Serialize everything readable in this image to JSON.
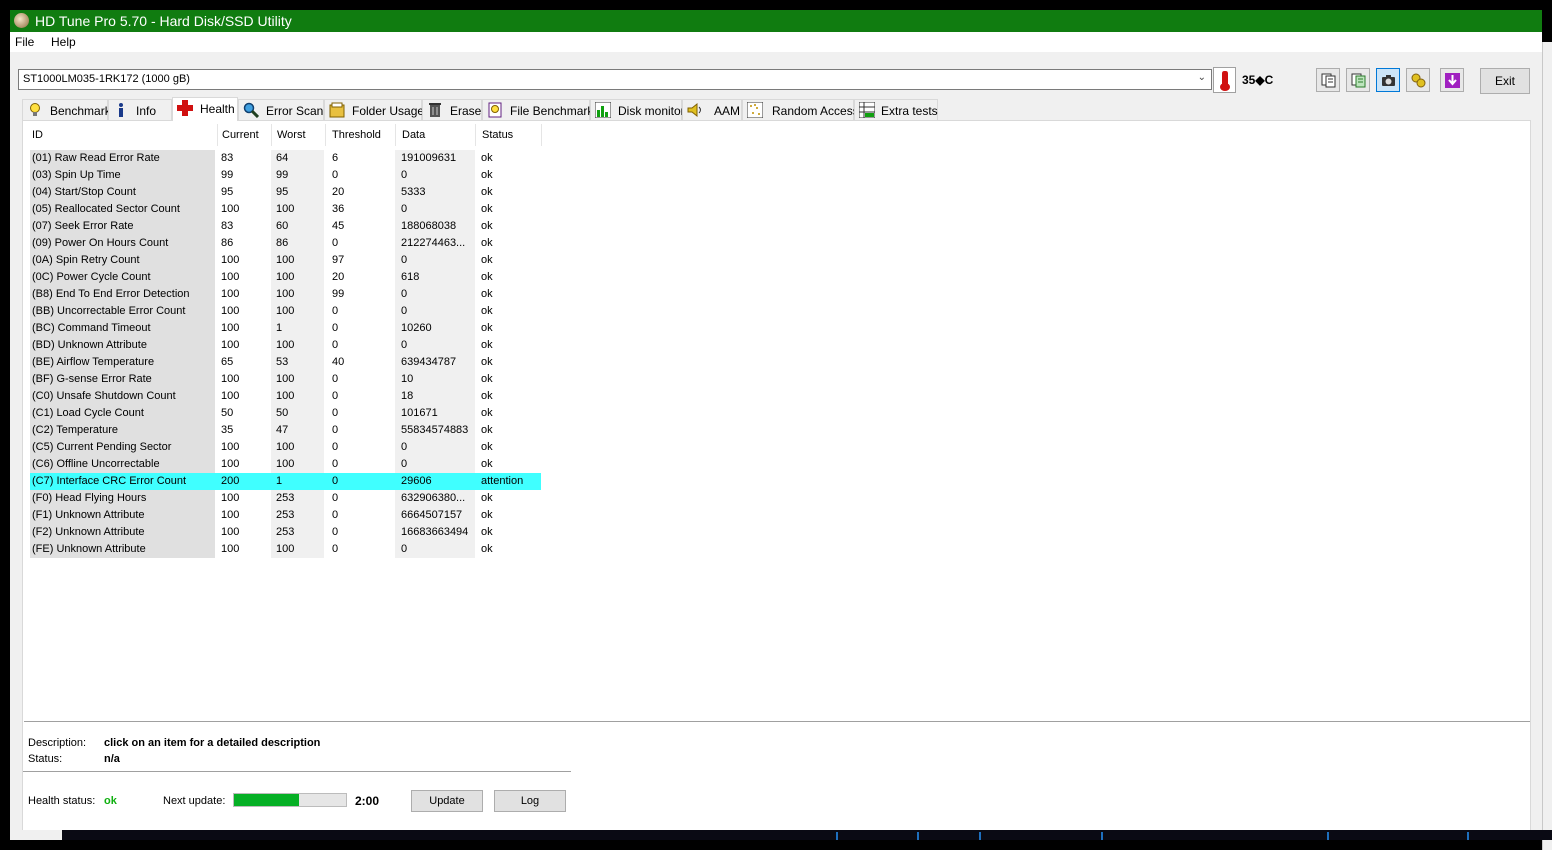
{
  "window": {
    "title": "HD Tune Pro 5.70 - Hard Disk/SSD Utility"
  },
  "menu": {
    "file": "File",
    "help": "Help"
  },
  "toolbar": {
    "drive": "ST1000LM035-1RK172 (1000 gB)",
    "temperature": "35◆C",
    "exit_label": "Exit",
    "icons": [
      "copy-icon",
      "copy-all-icon",
      "screenshot-icon",
      "options-icon",
      "save-icon"
    ]
  },
  "tabs": [
    {
      "label": "Benchmark",
      "icon": "benchmark-icon"
    },
    {
      "label": "Info",
      "icon": "info-icon"
    },
    {
      "label": "Health",
      "icon": "health-icon"
    },
    {
      "label": "Error Scan",
      "icon": "error-scan-icon"
    },
    {
      "label": "Folder Usage",
      "icon": "folder-icon"
    },
    {
      "label": "Erase",
      "icon": "erase-icon"
    },
    {
      "label": "File Benchmark",
      "icon": "file-benchmark-icon"
    },
    {
      "label": "Disk monitor",
      "icon": "disk-monitor-icon"
    },
    {
      "label": "AAM",
      "icon": "speaker-icon"
    },
    {
      "label": "Random Access",
      "icon": "random-access-icon"
    },
    {
      "label": "Extra tests",
      "icon": "extra-tests-icon"
    }
  ],
  "active_tab": "Health",
  "table": {
    "headers": [
      "ID",
      "Current",
      "Worst",
      "Threshold",
      "Data",
      "Status"
    ],
    "rows": [
      [
        "(01) Raw Read Error Rate",
        "83",
        "64",
        "6",
        "191009631",
        "ok"
      ],
      [
        "(03) Spin Up Time",
        "99",
        "99",
        "0",
        "0",
        "ok"
      ],
      [
        "(04) Start/Stop Count",
        "95",
        "95",
        "20",
        "5333",
        "ok"
      ],
      [
        "(05) Reallocated Sector Count",
        "100",
        "100",
        "36",
        "0",
        "ok"
      ],
      [
        "(07) Seek Error Rate",
        "83",
        "60",
        "45",
        "188068038",
        "ok"
      ],
      [
        "(09) Power On Hours Count",
        "86",
        "86",
        "0",
        "212274463...",
        "ok"
      ],
      [
        "(0A) Spin Retry Count",
        "100",
        "100",
        "97",
        "0",
        "ok"
      ],
      [
        "(0C) Power Cycle Count",
        "100",
        "100",
        "20",
        "618",
        "ok"
      ],
      [
        "(B8) End To End Error Detection",
        "100",
        "100",
        "99",
        "0",
        "ok"
      ],
      [
        "(BB) Uncorrectable Error Count",
        "100",
        "100",
        "0",
        "0",
        "ok"
      ],
      [
        "(BC) Command Timeout",
        "100",
        "1",
        "0",
        "10260",
        "ok"
      ],
      [
        "(BD) Unknown Attribute",
        "100",
        "100",
        "0",
        "0",
        "ok"
      ],
      [
        "(BE) Airflow Temperature",
        "65",
        "53",
        "40",
        "639434787",
        "ok"
      ],
      [
        "(BF) G-sense Error Rate",
        "100",
        "100",
        "0",
        "10",
        "ok"
      ],
      [
        "(C0) Unsafe Shutdown Count",
        "100",
        "100",
        "0",
        "18",
        "ok"
      ],
      [
        "(C1) Load Cycle Count",
        "50",
        "50",
        "0",
        "101671",
        "ok"
      ],
      [
        "(C2) Temperature",
        "35",
        "47",
        "0",
        "55834574883",
        "ok"
      ],
      [
        "(C5) Current Pending Sector",
        "100",
        "100",
        "0",
        "0",
        "ok"
      ],
      [
        "(C6) Offline Uncorrectable",
        "100",
        "100",
        "0",
        "0",
        "ok"
      ],
      [
        "(C7) Interface CRC Error Count",
        "200",
        "1",
        "0",
        "29606",
        "attention"
      ],
      [
        "(F0) Head Flying Hours",
        "100",
        "253",
        "0",
        "632906380...",
        "ok"
      ],
      [
        "(F1) Unknown Attribute",
        "100",
        "253",
        "0",
        "6664507157",
        "ok"
      ],
      [
        "(F2) Unknown Attribute",
        "100",
        "253",
        "0",
        "16683663494",
        "ok"
      ],
      [
        "(FE) Unknown Attribute",
        "100",
        "100",
        "0",
        "0",
        "ok"
      ]
    ],
    "highlight_color": "#40ffff"
  },
  "description": {
    "desc_label": "Description:",
    "desc_value": "click on an item for a detailed description",
    "status_label": "Status:",
    "status_value": "n/a"
  },
  "footer": {
    "health_label": "Health status:",
    "health_value": "ok",
    "next_label": "Next update:",
    "progress_fraction": 0.58,
    "timer": "2:00",
    "update_label": "Update",
    "log_label": "Log"
  },
  "colors": {
    "titlebar": "#107c10",
    "progress": "#06b025",
    "health_ok": "#10b010"
  }
}
